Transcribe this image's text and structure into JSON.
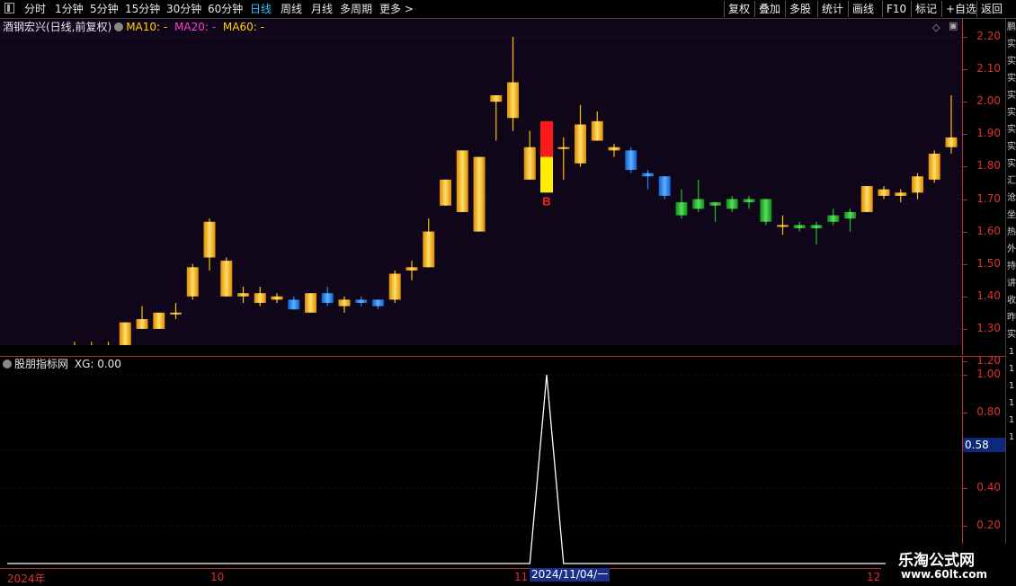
{
  "toolbar": {
    "left_items": [
      "分时",
      "1分钟",
      "5分钟",
      "15分钟",
      "30分钟",
      "60分钟",
      "日线",
      "周线",
      "月线",
      "多周期",
      "更多 >"
    ],
    "active_index": 6,
    "right_items": [
      "复权",
      "叠加",
      "多股",
      "统计",
      "画线",
      "F10",
      "标记",
      "+自选",
      "返回"
    ]
  },
  "main_legend": {
    "stock": "酒钢宏兴(日线,前复权)",
    "ma10": "MA10: -",
    "ma20": "MA20: -",
    "ma60": "MA60: -",
    "colors": {
      "ma10": "#ffd400",
      "ma20": "#ff3ccf",
      "ma60": "#ffd400"
    }
  },
  "ind_legend": {
    "name": "股朋指标网",
    "xg": "XG: 0.00"
  },
  "side_strip": [
    "鹏",
    "实",
    "实",
    "实",
    "实",
    "实",
    "实",
    "实",
    "实",
    "汇",
    "沧",
    "坐",
    "热",
    "外",
    "持",
    "讲",
    "收",
    "昨",
    "实",
    "1",
    "1",
    "1",
    "1",
    "1",
    "1"
  ],
  "date_axis": {
    "labels": [
      "2024年",
      "10",
      "11",
      "12"
    ],
    "cursor": "2024/11/04/一"
  },
  "watermark": {
    "title": "乐淘公式网",
    "url": "www.60lt.com"
  },
  "chart_data": [
    {
      "type": "candlestick",
      "title": "酒钢宏兴(日线,前复权)",
      "y_ticks": [
        "2.20",
        "2.10",
        "2.00",
        "1.90",
        "1.80",
        "1.70",
        "1.60",
        "1.50",
        "1.40",
        "1.30",
        "1.20"
      ],
      "ylim": [
        1.165,
        2.22
      ],
      "colors": {
        "up": "#ffc000",
        "down_blue": "#1e88ff",
        "green": "#22c02a",
        "signal_red": "#ff1a1a",
        "signal_yellow": "#ffee00"
      },
      "candles": [
        {
          "o": 1.19,
          "h": 1.2,
          "l": 1.19,
          "c": 1.2,
          "k": "up"
        },
        {
          "o": 1.19,
          "h": 1.21,
          "l": 1.19,
          "c": 1.21,
          "k": "up"
        },
        {
          "o": 1.2,
          "h": 1.23,
          "l": 1.2,
          "c": 1.23,
          "k": "up"
        },
        {
          "o": 1.23,
          "h": 1.24,
          "l": 1.22,
          "c": 1.23,
          "k": "up"
        },
        {
          "o": 1.23,
          "h": 1.26,
          "l": 1.22,
          "c": 1.25,
          "k": "up"
        },
        {
          "o": 1.25,
          "h": 1.26,
          "l": 1.24,
          "c": 1.25,
          "k": "up"
        },
        {
          "o": 1.24,
          "h": 1.26,
          "l": 1.22,
          "c": 1.25,
          "k": "up"
        },
        {
          "o": 1.25,
          "h": 1.32,
          "l": 1.25,
          "c": 1.32,
          "k": "up"
        },
        {
          "o": 1.3,
          "h": 1.37,
          "l": 1.3,
          "c": 1.33,
          "k": "up"
        },
        {
          "o": 1.3,
          "h": 1.35,
          "l": 1.3,
          "c": 1.35,
          "k": "up"
        },
        {
          "o": 1.35,
          "h": 1.38,
          "l": 1.33,
          "c": 1.35,
          "k": "up"
        },
        {
          "o": 1.4,
          "h": 1.5,
          "l": 1.39,
          "c": 1.49,
          "k": "up"
        },
        {
          "o": 1.52,
          "h": 1.64,
          "l": 1.48,
          "c": 1.63,
          "k": "up"
        },
        {
          "o": 1.4,
          "h": 1.52,
          "l": 1.4,
          "c": 1.51,
          "k": "up"
        },
        {
          "o": 1.4,
          "h": 1.43,
          "l": 1.38,
          "c": 1.41,
          "k": "up"
        },
        {
          "o": 1.38,
          "h": 1.43,
          "l": 1.37,
          "c": 1.41,
          "k": "up"
        },
        {
          "o": 1.39,
          "h": 1.41,
          "l": 1.38,
          "c": 1.4,
          "k": "up"
        },
        {
          "o": 1.39,
          "h": 1.4,
          "l": 1.36,
          "c": 1.36,
          "k": "down"
        },
        {
          "o": 1.35,
          "h": 1.41,
          "l": 1.35,
          "c": 1.41,
          "k": "up"
        },
        {
          "o": 1.41,
          "h": 1.43,
          "l": 1.37,
          "c": 1.38,
          "k": "down"
        },
        {
          "o": 1.37,
          "h": 1.4,
          "l": 1.35,
          "c": 1.39,
          "k": "up"
        },
        {
          "o": 1.39,
          "h": 1.4,
          "l": 1.37,
          "c": 1.38,
          "k": "down"
        },
        {
          "o": 1.39,
          "h": 1.39,
          "l": 1.36,
          "c": 1.37,
          "k": "down"
        },
        {
          "o": 1.39,
          "h": 1.48,
          "l": 1.38,
          "c": 1.47,
          "k": "up"
        },
        {
          "o": 1.48,
          "h": 1.51,
          "l": 1.45,
          "c": 1.49,
          "k": "up"
        },
        {
          "o": 1.49,
          "h": 1.64,
          "l": 1.49,
          "c": 1.6,
          "k": "up"
        },
        {
          "o": 1.68,
          "h": 1.76,
          "l": 1.68,
          "c": 1.76,
          "k": "up"
        },
        {
          "o": 1.66,
          "h": 1.85,
          "l": 1.66,
          "c": 1.85,
          "k": "up"
        },
        {
          "o": 1.6,
          "h": 1.83,
          "l": 1.6,
          "c": 1.83,
          "k": "up"
        },
        {
          "o": 2.0,
          "h": 2.02,
          "l": 1.88,
          "c": 2.02,
          "k": "up"
        },
        {
          "o": 1.95,
          "h": 2.2,
          "l": 1.91,
          "c": 2.06,
          "k": "up"
        },
        {
          "o": 1.76,
          "h": 1.91,
          "l": 1.76,
          "c": 1.86,
          "k": "up"
        },
        {
          "o": 1.72,
          "h": 1.94,
          "l": 1.72,
          "c": 1.94,
          "k": "signal"
        },
        {
          "o": 1.86,
          "h": 1.89,
          "l": 1.76,
          "c": 1.86,
          "k": "up"
        },
        {
          "o": 1.81,
          "h": 1.99,
          "l": 1.8,
          "c": 1.93,
          "k": "up"
        },
        {
          "o": 1.88,
          "h": 1.97,
          "l": 1.88,
          "c": 1.94,
          "k": "up"
        },
        {
          "o": 1.86,
          "h": 1.87,
          "l": 1.83,
          "c": 1.85,
          "k": "up"
        },
        {
          "o": 1.85,
          "h": 1.86,
          "l": 1.78,
          "c": 1.79,
          "k": "down"
        },
        {
          "o": 1.78,
          "h": 1.79,
          "l": 1.73,
          "c": 1.77,
          "k": "down"
        },
        {
          "o": 1.77,
          "h": 1.77,
          "l": 1.7,
          "c": 1.71,
          "k": "down"
        },
        {
          "o": 1.69,
          "h": 1.73,
          "l": 1.64,
          "c": 1.65,
          "k": "green"
        },
        {
          "o": 1.7,
          "h": 1.76,
          "l": 1.66,
          "c": 1.67,
          "k": "green"
        },
        {
          "o": 1.69,
          "h": 1.69,
          "l": 1.63,
          "c": 1.68,
          "k": "green"
        },
        {
          "o": 1.7,
          "h": 1.71,
          "l": 1.66,
          "c": 1.67,
          "k": "green"
        },
        {
          "o": 1.7,
          "h": 1.71,
          "l": 1.67,
          "c": 1.69,
          "k": "green"
        },
        {
          "o": 1.7,
          "h": 1.7,
          "l": 1.62,
          "c": 1.63,
          "k": "green"
        },
        {
          "o": 1.62,
          "h": 1.65,
          "l": 1.59,
          "c": 1.62,
          "k": "up"
        },
        {
          "o": 1.62,
          "h": 1.63,
          "l": 1.6,
          "c": 1.61,
          "k": "green"
        },
        {
          "o": 1.62,
          "h": 1.63,
          "l": 1.56,
          "c": 1.61,
          "k": "green"
        },
        {
          "o": 1.63,
          "h": 1.67,
          "l": 1.62,
          "c": 1.65,
          "k": "green"
        },
        {
          "o": 1.64,
          "h": 1.67,
          "l": 1.6,
          "c": 1.66,
          "k": "green"
        },
        {
          "o": 1.66,
          "h": 1.74,
          "l": 1.66,
          "c": 1.74,
          "k": "up"
        },
        {
          "o": 1.71,
          "h": 1.74,
          "l": 1.7,
          "c": 1.73,
          "k": "up"
        },
        {
          "o": 1.71,
          "h": 1.73,
          "l": 1.69,
          "c": 1.72,
          "k": "up"
        },
        {
          "o": 1.72,
          "h": 1.78,
          "l": 1.7,
          "c": 1.77,
          "k": "up"
        },
        {
          "o": 1.76,
          "h": 1.85,
          "l": 1.75,
          "c": 1.84,
          "k": "up"
        },
        {
          "o": 1.86,
          "h": 2.02,
          "l": 1.84,
          "c": 1.89,
          "k": "up"
        }
      ],
      "signal_index": 32,
      "signal_label": "B",
      "signal_label_color": "#ff2020"
    },
    {
      "type": "line",
      "title": "股朋指标网",
      "series": [
        {
          "name": "XG",
          "values": [
            0,
            0,
            0,
            0,
            0,
            0,
            0,
            0,
            0,
            0,
            0,
            0,
            0,
            0,
            0,
            0,
            0,
            0,
            0,
            0,
            0,
            0,
            0,
            0,
            0,
            0,
            0,
            0,
            0,
            0,
            0,
            0,
            1,
            0,
            0,
            0,
            0,
            0,
            0,
            0,
            0,
            0,
            0,
            0,
            0,
            0,
            0,
            0,
            0,
            0,
            0,
            0,
            0,
            0,
            0,
            0,
            0
          ]
        }
      ],
      "y_ticks": [
        "1.00",
        "0.80",
        "0.40",
        "0.20"
      ],
      "cursor_value": "0.58",
      "ylim": [
        0,
        1.05
      ],
      "line_color": "#ffffff"
    }
  ]
}
